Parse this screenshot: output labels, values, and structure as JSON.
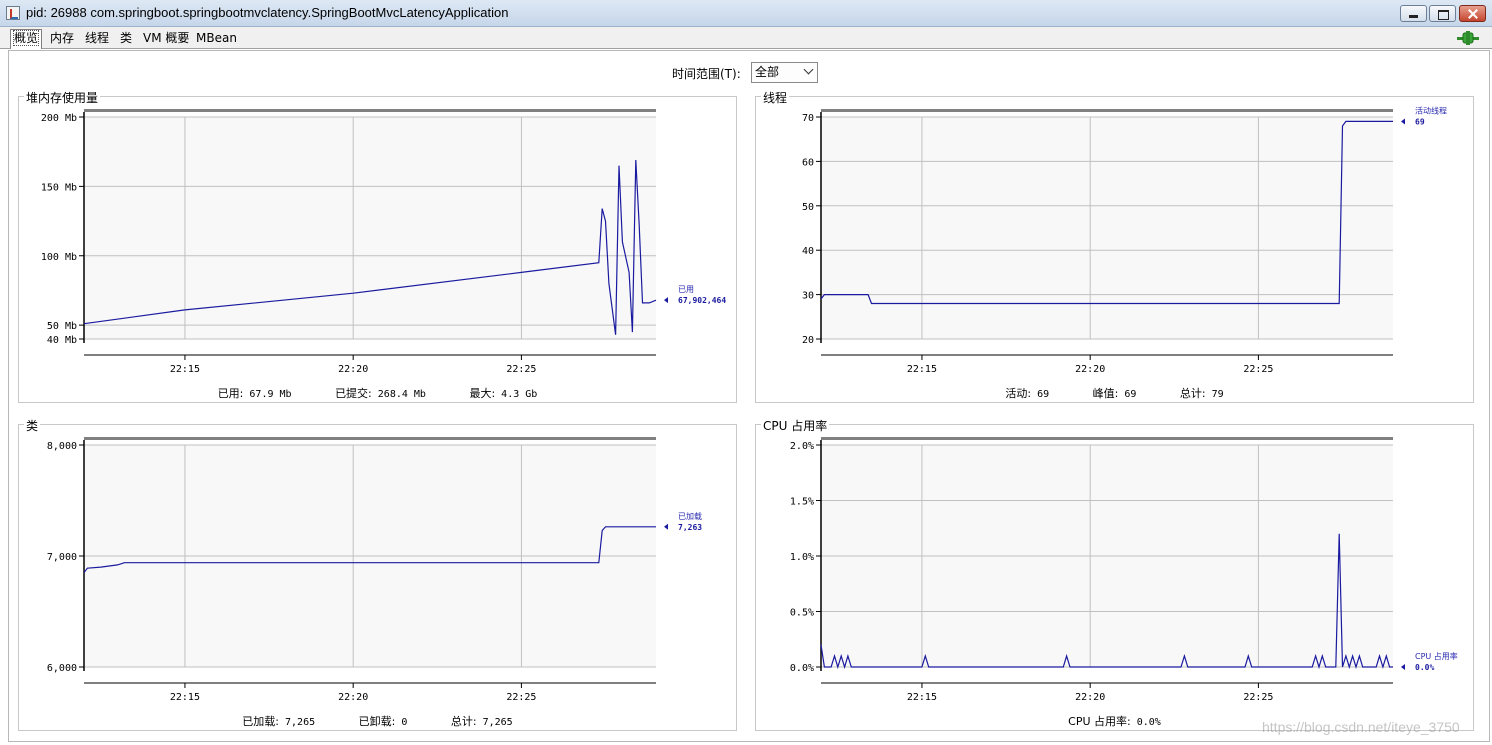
{
  "window": {
    "title": "pid: 26988 com.springboot.springbootmvclatency.SpringBootMvcLatencyApplication"
  },
  "tabs": [
    "概览",
    "内存",
    "线程",
    "类",
    "VM 概要",
    "MBean"
  ],
  "time_range": {
    "label": "时间范围(T):",
    "value": "全部"
  },
  "panels": {
    "heap": {
      "title": "堆内存使用量",
      "legend_name": "已用",
      "legend_value": "67,902,464",
      "stats": [
        {
          "label": "已用:",
          "value": "67.9  Mb"
        },
        {
          "label": "已提交:",
          "value": "268.4  Mb"
        },
        {
          "label": "最大:",
          "value": "4.3  Gb"
        }
      ]
    },
    "threads": {
      "title": "线程",
      "legend_name": "活动线程",
      "legend_value": "69",
      "stats": [
        {
          "label": "活动:",
          "value": "69"
        },
        {
          "label": "峰值:",
          "value": "69"
        },
        {
          "label": "总计:",
          "value": "79"
        }
      ]
    },
    "classes": {
      "title": "类",
      "legend_name": "已加载",
      "legend_value": "7,263",
      "stats": [
        {
          "label": "已加载:",
          "value": "7,265"
        },
        {
          "label": "已卸载:",
          "value": "0"
        },
        {
          "label": "总计:",
          "value": "7,265"
        }
      ]
    },
    "cpu": {
      "title": "CPU 占用率",
      "legend_name": "CPU 占用率",
      "legend_value": "0.0%",
      "stats": [
        {
          "label": "CPU 占用率:",
          "value": "0.0%"
        }
      ]
    }
  },
  "colors": {
    "series": "#1a1aa0",
    "grid": "#c0c0c0",
    "plot_bg": "#f8f8f8"
  },
  "chart_data": [
    {
      "type": "line",
      "title": "堆内存使用量",
      "xlabel": "",
      "ylabel": "",
      "x_ticks": [
        "22:15",
        "22:20",
        "22:25"
      ],
      "y_ticks": [
        "40 Mb",
        "50 Mb",
        "100 Mb",
        "150 Mb",
        "200 Mb"
      ],
      "ylim": [
        40,
        200
      ],
      "xlim": [
        "22:12",
        "22:29"
      ],
      "grid": true,
      "series": [
        {
          "name": "已用",
          "x": [
            "22:12",
            "22:15",
            "22:20",
            "22:25",
            "22:27.3",
            "22:27.4",
            "22:27.5",
            "22:27.6",
            "22:27.8",
            "22:27.9",
            "22:28.0",
            "22:28.2",
            "22:28.3",
            "22:28.4",
            "22:28.5",
            "22:28.6",
            "22:28.8",
            "22:29"
          ],
          "values": [
            51,
            61,
            73,
            88,
            95,
            134,
            125,
            80,
            43,
            165,
            110,
            88,
            45,
            169,
            122,
            66,
            66,
            68
          ]
        }
      ]
    },
    {
      "type": "line",
      "title": "线程",
      "xlabel": "",
      "ylabel": "",
      "x_ticks": [
        "22:15",
        "22:20",
        "22:25"
      ],
      "y_ticks": [
        "20",
        "30",
        "40",
        "50",
        "60",
        "70"
      ],
      "ylim": [
        20,
        70
      ],
      "xlim": [
        "22:12",
        "22:29"
      ],
      "grid": true,
      "series": [
        {
          "name": "活动线程",
          "x": [
            "22:12",
            "22:12.1",
            "22:13.4",
            "22:13.5",
            "22:27.4",
            "22:27.5",
            "22:27.6",
            "22:29"
          ],
          "values": [
            29,
            30,
            30,
            28,
            28,
            68,
            69,
            69
          ]
        }
      ]
    },
    {
      "type": "line",
      "title": "类",
      "xlabel": "",
      "ylabel": "",
      "x_ticks": [
        "22:15",
        "22:20",
        "22:25"
      ],
      "y_ticks": [
        "6,000",
        "7,000",
        "8,000"
      ],
      "ylim": [
        6000,
        8000
      ],
      "xlim": [
        "22:12",
        "22:29"
      ],
      "grid": true,
      "series": [
        {
          "name": "已加载",
          "x": [
            "22:12",
            "22:12.1",
            "22:12.5",
            "22:13",
            "22:13.2",
            "22:27.3",
            "22:27.4",
            "22:27.5",
            "22:29"
          ],
          "values": [
            6850,
            6890,
            6900,
            6920,
            6940,
            6940,
            7230,
            7263,
            7263
          ]
        }
      ]
    },
    {
      "type": "line",
      "title": "CPU 占用率",
      "xlabel": "",
      "ylabel": "",
      "x_ticks": [
        "22:15",
        "22:20",
        "22:25"
      ],
      "y_ticks": [
        "0.0%",
        "0.5%",
        "1.0%",
        "1.5%",
        "2.0%"
      ],
      "ylim": [
        0,
        2
      ],
      "xlim": [
        "22:12",
        "22:29"
      ],
      "grid": true,
      "series": [
        {
          "name": "CPU 占用率",
          "x": [
            "22:12",
            "22:12.1",
            "22:12.3",
            "22:12.4",
            "22:12.5",
            "22:12.6",
            "22:12.7",
            "22:12.8",
            "22:12.9",
            "22:13.0",
            "22:15.0",
            "22:15.1",
            "22:15.2",
            "22:19.2",
            "22:19.3",
            "22:19.4",
            "22:22.7",
            "22:22.8",
            "22:22.9",
            "22:24.6",
            "22:24.7",
            "22:24.8",
            "22:26.6",
            "22:26.7",
            "22:26.8",
            "22:26.9",
            "22:27.0",
            "22:27.3",
            "22:27.4",
            "22:27.5",
            "22:27.6",
            "22:27.7",
            "22:27.8",
            "22:27.9",
            "22:28.0",
            "22:28.1",
            "22:28.5",
            "22:28.6",
            "22:28.7",
            "22:28.8",
            "22:28.9",
            "22:29"
          ],
          "values": [
            0.2,
            0,
            0,
            0.1,
            0,
            0.1,
            0,
            0.1,
            0,
            0,
            0,
            0.1,
            0,
            0,
            0.1,
            0,
            0,
            0.1,
            0,
            0,
            0.1,
            0,
            0,
            0.1,
            0,
            0.1,
            0,
            0,
            1.2,
            0,
            0.1,
            0,
            0.1,
            0,
            0.1,
            0,
            0,
            0.1,
            0,
            0.1,
            0,
            0
          ]
        }
      ]
    }
  ]
}
